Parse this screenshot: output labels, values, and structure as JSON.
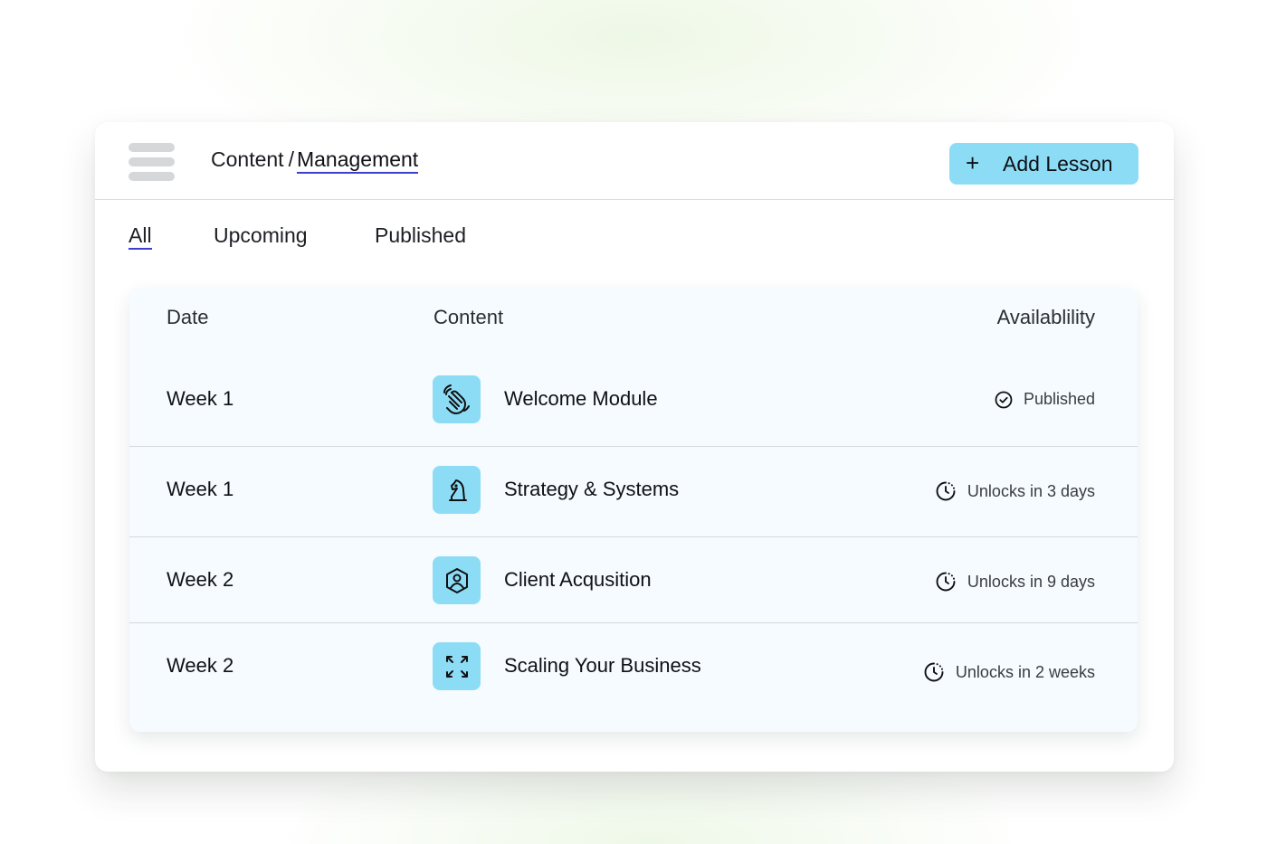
{
  "header": {
    "breadcrumb_root": "Content",
    "breadcrumb_separator": "/",
    "breadcrumb_current": "Management",
    "add_button_icon": "+",
    "add_button_label": "Add Lesson"
  },
  "tabs": [
    {
      "label": "All",
      "active": true
    },
    {
      "label": "Upcoming",
      "active": false
    },
    {
      "label": "Published",
      "active": false
    }
  ],
  "table": {
    "columns": [
      "Date",
      "Content",
      "Availablility"
    ],
    "rows": [
      {
        "date": "Week 1",
        "title": "Welcome Module",
        "icon": "waving-hand-icon",
        "status_icon": "check-circle-icon",
        "availability": "Published"
      },
      {
        "date": "Week 1",
        "title": "Strategy & Systems",
        "icon": "chess-knight-icon",
        "status_icon": "clock-dashed-icon",
        "availability": "Unlocks in 3 days"
      },
      {
        "date": "Week 2",
        "title": "Client Acqusition",
        "icon": "user-hexagon-icon",
        "status_icon": "clock-dashed-icon",
        "availability": "Unlocks in 9 days"
      },
      {
        "date": "Week 2",
        "title": "Scaling Your Business",
        "icon": "expand-arrows-icon",
        "status_icon": "clock-dashed-icon",
        "availability": "Unlocks in 2 weeks"
      }
    ]
  },
  "colors": {
    "accent": "#8ddcf6",
    "underline": "#3b3fd0",
    "table_bg": "#f5fbfe",
    "menu_bars": "#d6d7d9"
  }
}
